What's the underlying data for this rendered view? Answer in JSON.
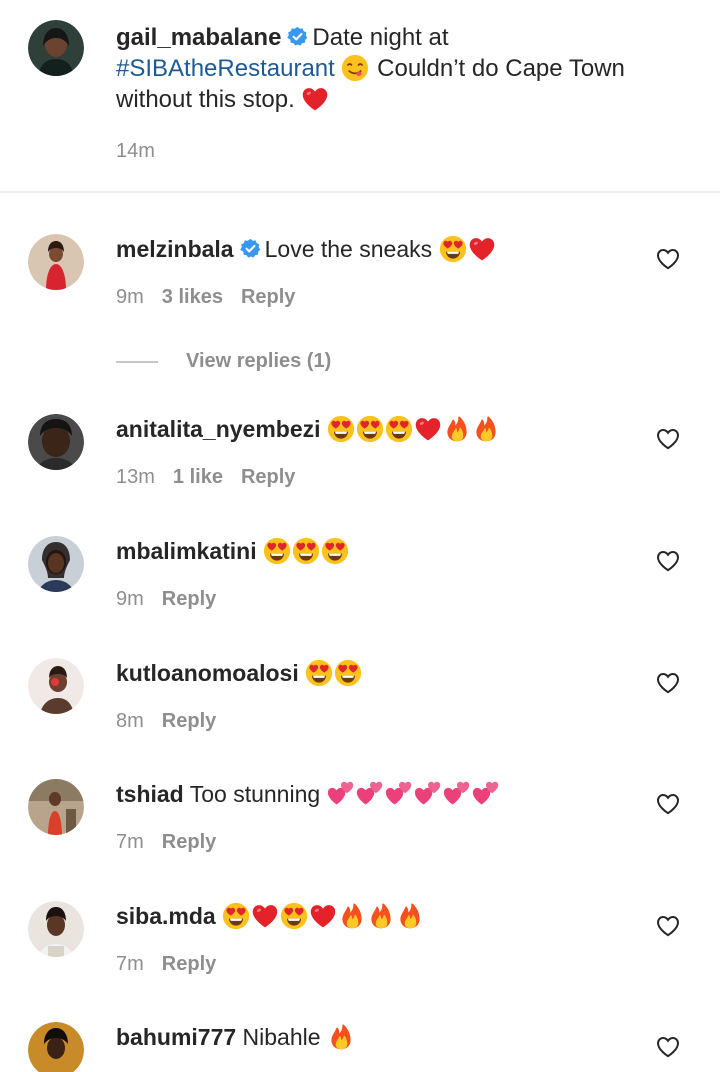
{
  "caption": {
    "username": "gail_mabalane",
    "text_before_tag": "Date night at",
    "hashtag": "#SIBAtheRestaurant",
    "text_after": "Couldn’t do Cape Town without this stop.",
    "time": "14m"
  },
  "comments": [
    {
      "username": "melzinbala",
      "text": "Love the sneaks",
      "time": "9m",
      "likes": "3 likes",
      "reply": "Reply",
      "view_replies": "View replies (1)"
    },
    {
      "username": "anitalita_nyembezi",
      "text": "",
      "time": "13m",
      "likes": "1 like",
      "reply": "Reply"
    },
    {
      "username": "mbalimkatini",
      "text": "",
      "time": "9m",
      "reply": "Reply"
    },
    {
      "username": "kutloanomoalosi",
      "text": "",
      "time": "8m",
      "reply": "Reply"
    },
    {
      "username": "tshiad",
      "text": "Too stunning",
      "time": "7m",
      "reply": "Reply"
    },
    {
      "username": "siba.mda",
      "text": "",
      "time": "7m",
      "reply": "Reply"
    },
    {
      "username": "bahumi777",
      "text": "Nibahle"
    }
  ],
  "icons": {
    "verified": "verified-badge-icon",
    "like": "heart-outline-icon",
    "emoji_heart_eyes": "heart-eyes-emoji",
    "emoji_red_heart": "red-heart-emoji",
    "emoji_fire": "fire-emoji",
    "emoji_yum": "yum-face-emoji",
    "emoji_two_hearts": "two-hearts-emoji"
  },
  "colors": {
    "verified": "#3897f0",
    "hashtag": "#1e5a96",
    "muted": "#8e8e8e",
    "text": "#262626"
  }
}
